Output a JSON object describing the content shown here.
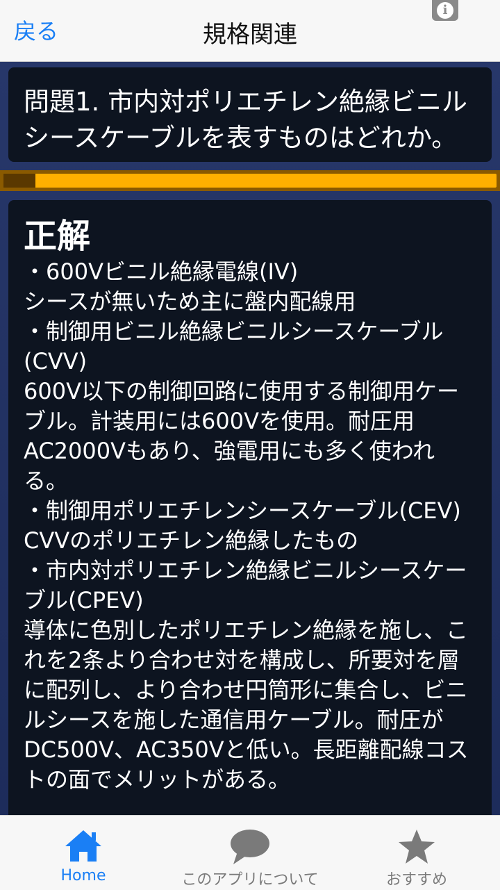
{
  "navbar": {
    "back_label": "戻る",
    "title": "規格関連",
    "info_icon": "info-icon"
  },
  "question": {
    "text": "問題1. 市内対ポリエチレン絶縁ビニルシースケーブルを表すものはどれか。"
  },
  "progress": {
    "fraction": 0.065
  },
  "answer": {
    "heading": "正解",
    "body": "・600Vビニル絶縁電線(IV)\nシースが無いため主に盤内配線用\n・制御用ビニル絶縁ビニルシースケーブル(CVV)\n600V以下の制御回路に使用する制御用ケーブル。計装用には600Vを使用。耐圧用AC2000Vもあり、強電用にも多く使われる。\n・制御用ポリエチレンシースケーブル(CEV)\nCVVのポリエチレン絶縁したもの\n・市内対ポリエチレン絶縁ビニルシースケーブル(CPEV)\n導体に色別したポリエチレン絶縁を施し、これを2条より合わせ対を構成し、所要対を層に配列し、より合わせ円筒形に集合し、ビニルシースを施した通信用ケーブル。耐圧がDC500V、AC350Vと低い。長距離配線コストの面でメリットがある。"
  },
  "tabbar": {
    "tabs": [
      {
        "label": "Home",
        "icon": "home-icon",
        "active": true
      },
      {
        "label": "このアプリについて",
        "icon": "speech-bubble-icon",
        "active": false
      },
      {
        "label": "おすすめ",
        "icon": "star-icon",
        "active": false
      }
    ]
  },
  "colors": {
    "accent": "#1a7ff5",
    "card_bg": "#0d1420",
    "progress": "#ffb000"
  }
}
